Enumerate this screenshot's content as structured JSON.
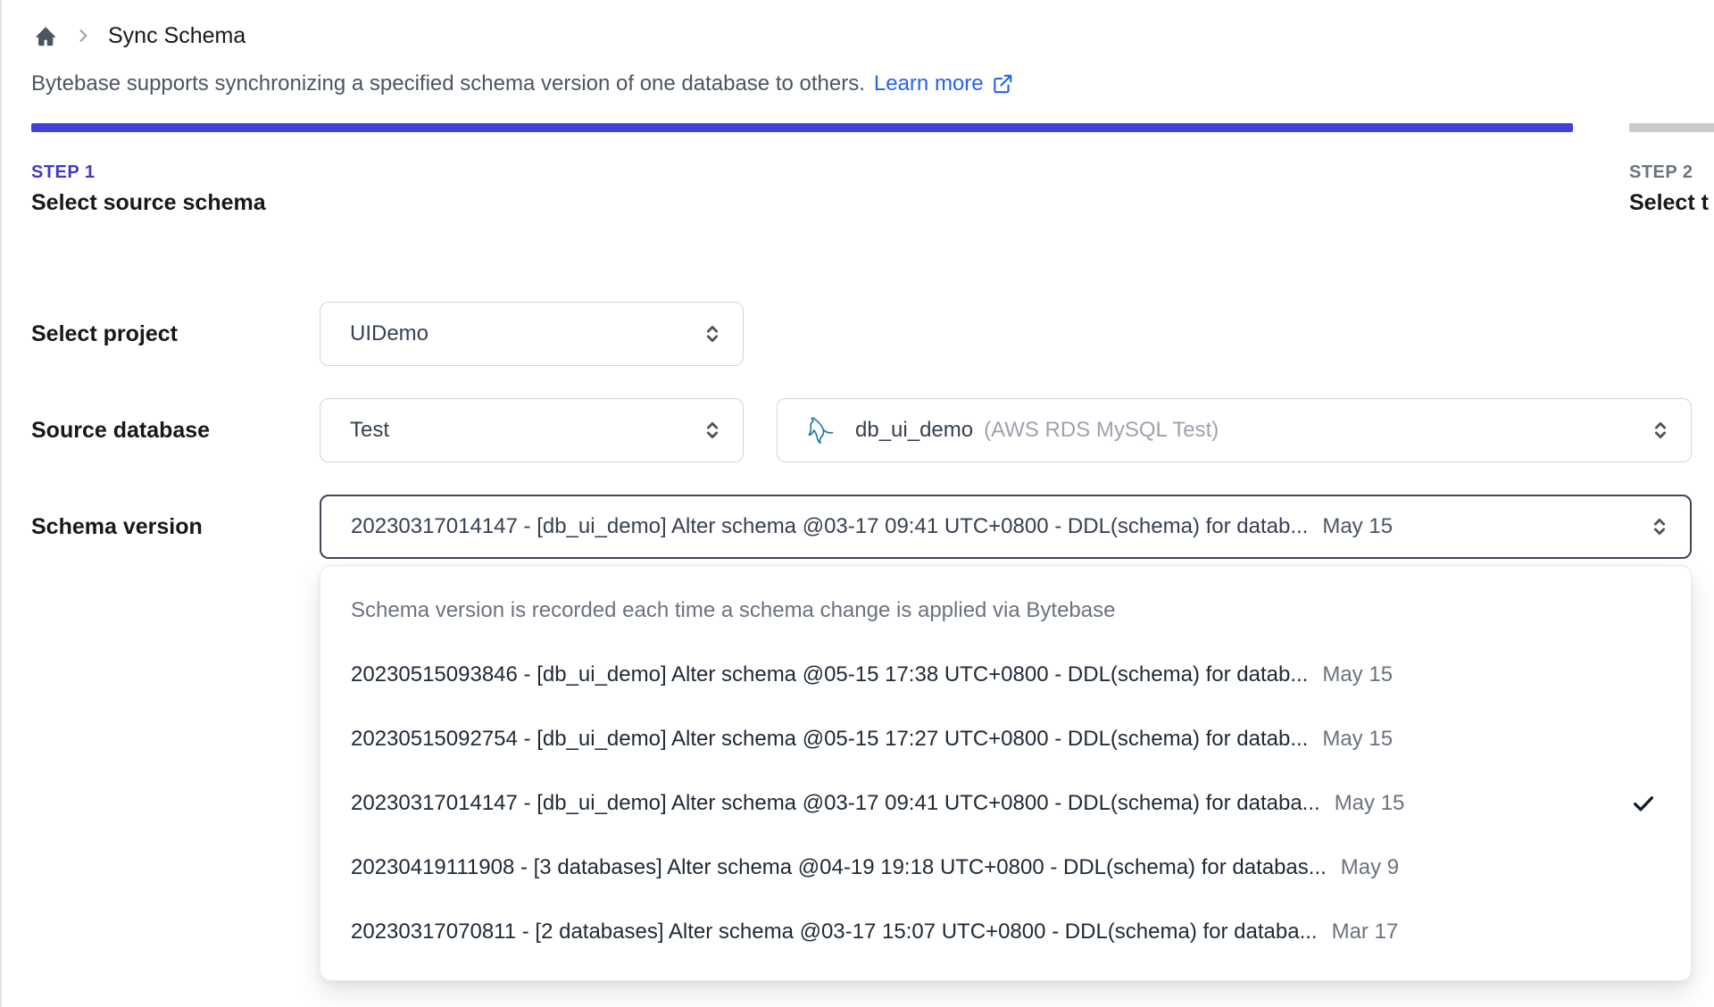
{
  "breadcrumb": {
    "title": "Sync Schema"
  },
  "intro": {
    "text": "Bytebase supports synchronizing a specified schema version of one database to others.",
    "link_label": "Learn more"
  },
  "colors": {
    "accent_indigo": "#4340d9",
    "step_active_text": "#4338ca",
    "inactive_bar": "#c8cbcf",
    "link_blue": "#2563eb",
    "mysql_teal": "#1d7a9c"
  },
  "steps": [
    {
      "label": "STEP 1",
      "title": "Select source schema",
      "state": "active"
    },
    {
      "label": "STEP 2",
      "title": "Select t",
      "state": "upcoming"
    }
  ],
  "form": {
    "project": {
      "label": "Select project",
      "value": "UIDemo"
    },
    "source_database": {
      "label": "Source database",
      "environment_value": "Test",
      "database": {
        "icon": "mysql-icon",
        "name": "db_ui_demo",
        "detail": "(AWS RDS MySQL Test)"
      }
    },
    "schema_version": {
      "label": "Schema version",
      "value": "20230317014147 - [db_ui_demo] Alter schema @03-17 09:41 UTC+0800 - DDL(schema) for datab...",
      "date": "May 15"
    }
  },
  "dropdown": {
    "hint": "Schema version is recorded each time a schema change is applied via Bytebase",
    "options": [
      {
        "text": "20230515093846 - [db_ui_demo] Alter schema @05-15 17:38 UTC+0800 - DDL(schema) for datab...",
        "date": "May 15",
        "selected": false
      },
      {
        "text": "20230515092754 - [db_ui_demo] Alter schema @05-15 17:27 UTC+0800 - DDL(schema) for datab...",
        "date": "May 15",
        "selected": false
      },
      {
        "text": "20230317014147 - [db_ui_demo] Alter schema @03-17 09:41 UTC+0800 - DDL(schema) for databa...",
        "date": "May 15",
        "selected": true
      },
      {
        "text": "20230419111908 - [3 databases] Alter schema @04-19 19:18 UTC+0800 - DDL(schema) for databas...",
        "date": "May 9",
        "selected": false
      },
      {
        "text": "20230317070811 - [2 databases] Alter schema @03-17 15:07 UTC+0800 - DDL(schema) for databa...",
        "date": "Mar 17",
        "selected": false
      }
    ]
  }
}
